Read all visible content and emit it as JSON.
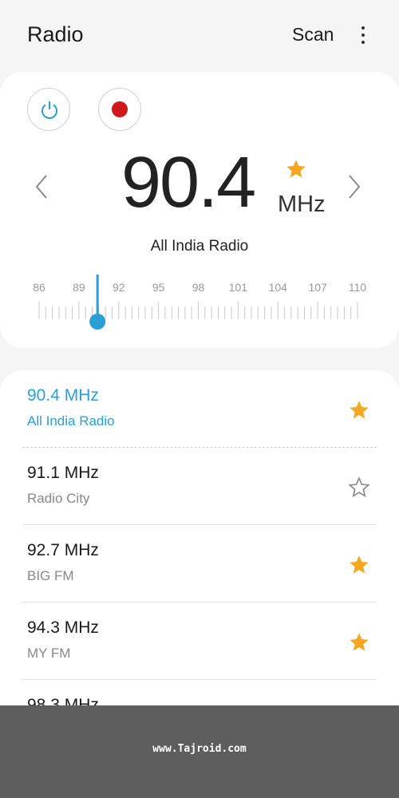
{
  "appbar": {
    "title": "Radio",
    "scan_label": "Scan"
  },
  "tuner": {
    "frequency": "90.4",
    "unit": "MHz",
    "station": "All India Radio",
    "favorite": true,
    "scale_labels": [
      "86",
      "89",
      "92",
      "95",
      "98",
      "101",
      "104",
      "107",
      "110"
    ],
    "scale_min": 86,
    "scale_max": 110,
    "current_value": 90.4
  },
  "stations": [
    {
      "freq": "90.4 MHz",
      "name": "All India Radio",
      "favorite": true,
      "active": true
    },
    {
      "freq": "91.1 MHz",
      "name": "Radio City",
      "favorite": false,
      "active": false
    },
    {
      "freq": "92.7 MHz",
      "name": "BIG FM",
      "favorite": true,
      "active": false
    },
    {
      "freq": "94.3 MHz",
      "name": "MY FM",
      "favorite": true,
      "active": false
    },
    {
      "freq": "98.3 MHz",
      "name": "",
      "favorite": false,
      "active": false
    }
  ],
  "footer": {
    "watermark": "www.Tajroid.com"
  },
  "colors": {
    "accent": "#2a9fd6",
    "star": "#f5a623",
    "record": "#d0171c",
    "footer": "#5e5e5e"
  }
}
